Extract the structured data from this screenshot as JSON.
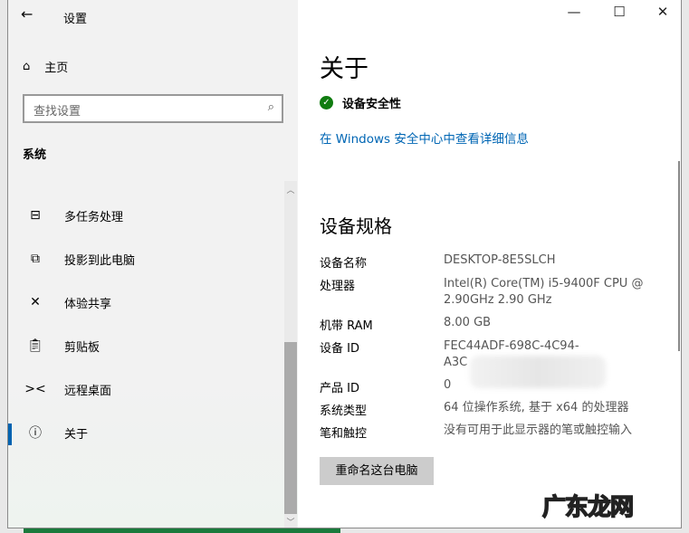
{
  "window": {
    "title": "设置",
    "back_icon": "arrow-left-icon",
    "min": "—",
    "max": "☐",
    "close": "✕"
  },
  "sidebar": {
    "home": "主页",
    "search_placeholder": "查找设置",
    "section": "系统",
    "items": [
      {
        "label": "多任务处理",
        "icon": "multitask-icon"
      },
      {
        "label": "投影到此电脑",
        "icon": "project-icon"
      },
      {
        "label": "体验共享",
        "icon": "share-icon"
      },
      {
        "label": "剪贴板",
        "icon": "clipboard-icon"
      },
      {
        "label": "远程桌面",
        "icon": "remote-desktop-icon"
      },
      {
        "label": "关于",
        "icon": "info-icon"
      }
    ]
  },
  "main": {
    "title": "关于",
    "security": "设备安全性",
    "security_link": "在 Windows 安全中心中查看详细信息",
    "specs_title": "设备规格",
    "specs": [
      {
        "label": "设备名称",
        "value": "DESKTOP-8E5SLCH"
      },
      {
        "label": "处理器",
        "value": "Intel(R) Core(TM) i5-9400F CPU @",
        "value2": "2.90GHz   2.90 GHz"
      },
      {
        "label": "机带 RAM",
        "value": "8.00 GB"
      },
      {
        "label": "设备 ID",
        "value": "FEC44ADF-698C-4C94-",
        "value2": "A3C"
      },
      {
        "label": "产品 ID",
        "value": "0"
      },
      {
        "label": "系统类型",
        "value": "64 位操作系统, 基于 x64 的处理器"
      },
      {
        "label": "笔和触控",
        "value": "没有可用于此显示器的笔或触控输入"
      }
    ],
    "rename_button": "重命名这台电脑"
  },
  "watermark": "广东龙网"
}
